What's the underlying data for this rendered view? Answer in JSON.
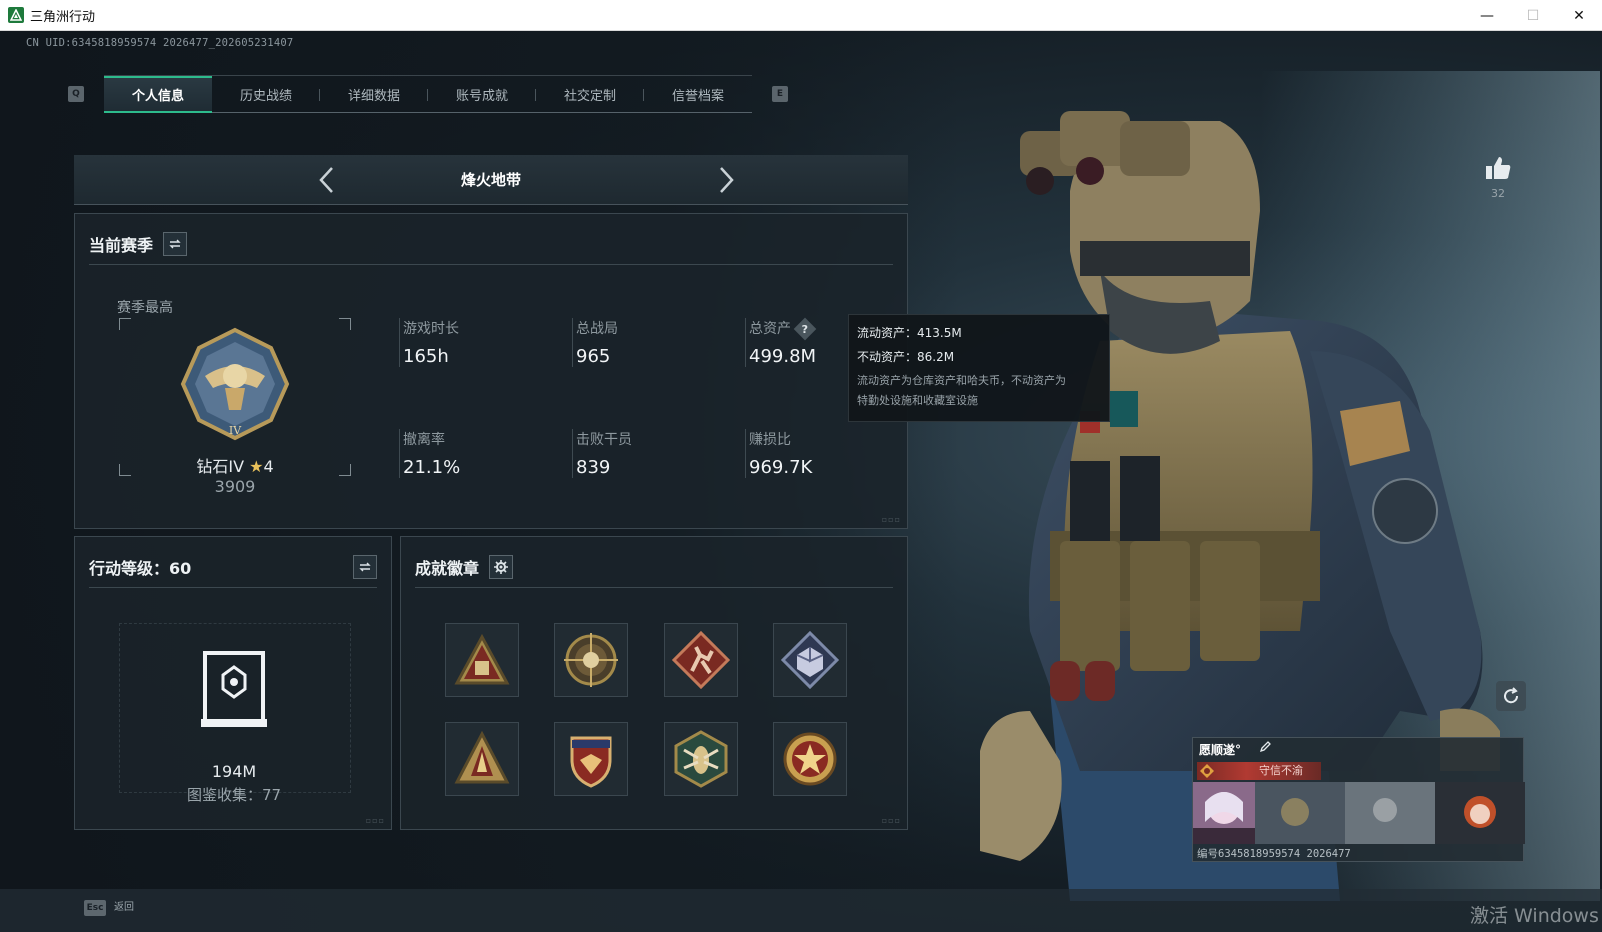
{
  "window": {
    "title": "三角洲行动",
    "minimize": "—",
    "maximize": "☐",
    "close": "✕"
  },
  "uid_line": "CN UID:6345818959574 2026477_202605231407",
  "tabs": {
    "left_key": "Q",
    "right_key": "E",
    "items": [
      {
        "label": "个人信息",
        "active": true
      },
      {
        "label": "历史战绩",
        "active": false
      },
      {
        "label": "详细数据",
        "active": false
      },
      {
        "label": "账号成就",
        "active": false
      },
      {
        "label": "社交定制",
        "active": false
      },
      {
        "label": "信誉档案",
        "active": false
      }
    ]
  },
  "mode": {
    "title": "烽火地带"
  },
  "season": {
    "heading": "当前赛季",
    "sub": "赛季最高",
    "rank_name": "钻石IV",
    "rank_stars": "4",
    "rank_score": "3909",
    "stats": [
      {
        "label": "游戏时长",
        "value": "165h"
      },
      {
        "label": "总战局",
        "value": "965"
      },
      {
        "label": "总资产",
        "value": "499.8M"
      },
      {
        "label": "撤离率",
        "value": "21.1%"
      },
      {
        "label": "击败干员",
        "value": "839"
      },
      {
        "label": "赚损比",
        "value": "969.7K"
      }
    ],
    "help": "?"
  },
  "tooltip": {
    "line1": "流动资产：413.5M",
    "line2": "不动资产：86.2M",
    "note1": "流动资产为仓库资产和哈夫币，不动资产为",
    "note2": "特勤处设施和收藏室设施"
  },
  "level": {
    "heading": "行动等级：60",
    "value": "194M",
    "collection": "图鉴收集：77"
  },
  "badges": {
    "heading": "成就徽章",
    "items": [
      "triangle-crate-badge",
      "skull-crosshair-badge",
      "runner-badge",
      "cube-badge",
      "triangle-flame-badge",
      "shield-wings-badge",
      "hornet-badge",
      "star-medal-badge"
    ]
  },
  "likes": {
    "count": "32"
  },
  "namecard": {
    "name": "愿顺遂°",
    "tagline": "守信不渝",
    "id_line": "编号6345818959574 2026477"
  },
  "footer": {
    "esc_key": "Esc",
    "back_label": "返回",
    "activate": "激活 Windows"
  },
  "colors": {
    "accent": "#2dbb8c",
    "title_bar": "#ffffff",
    "panel_bg": "#1a232a",
    "gold": "#e9c15a",
    "tag_red": "#b13a32"
  }
}
